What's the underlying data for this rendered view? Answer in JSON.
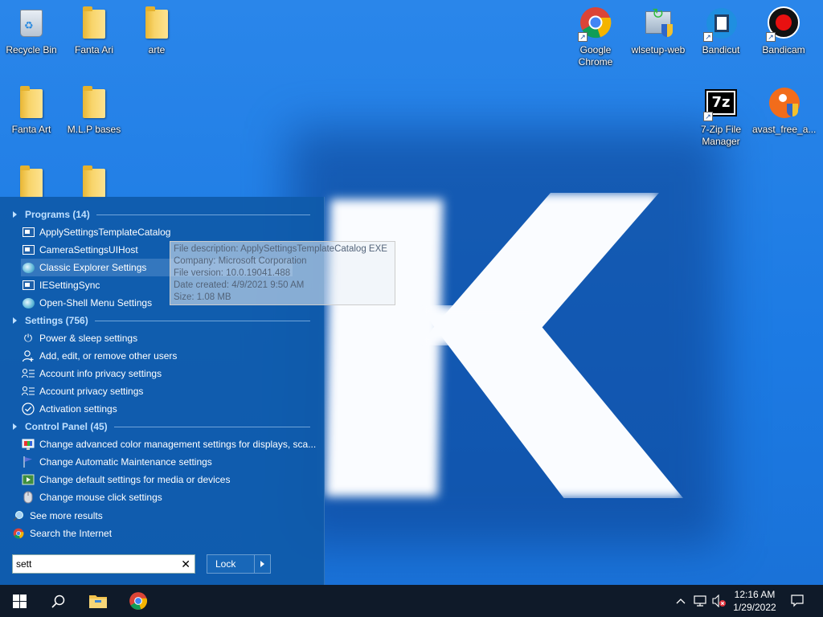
{
  "desktop": {
    "icons": [
      {
        "label": "Recycle Bin"
      },
      {
        "label": "Fanta Ari"
      },
      {
        "label": "arte"
      },
      {
        "label": "Fanta Art"
      },
      {
        "label": "M.L.P bases"
      },
      {
        "label": "Google Chrome"
      },
      {
        "label": "wlsetup-web"
      },
      {
        "label": "Bandicut"
      },
      {
        "label": "Bandicam"
      },
      {
        "label": "7-Zip File Manager"
      },
      {
        "label": "avast_free_a..."
      }
    ]
  },
  "start_menu": {
    "programs_header": "Programs (14)",
    "programs": [
      {
        "label": "ApplySettingsTemplateCatalog",
        "icon": "window-icon"
      },
      {
        "label": "CameraSettingsUIHost",
        "icon": "window-icon"
      },
      {
        "label": "Classic Explorer Settings",
        "icon": "shell-icon"
      },
      {
        "label": "IESettingSync",
        "icon": "window-icon"
      },
      {
        "label": "Open-Shell Menu Settings",
        "icon": "shell-icon"
      }
    ],
    "settings_header": "Settings (756)",
    "settings": [
      {
        "label": "Power & sleep settings",
        "icon": "power-icon"
      },
      {
        "label": "Add, edit, or remove other users",
        "icon": "person-icon"
      },
      {
        "label": "Account info privacy settings",
        "icon": "account-list-icon"
      },
      {
        "label": "Account privacy settings",
        "icon": "account-list-icon"
      },
      {
        "label": "Activation settings",
        "icon": "checkmark-circle-icon"
      }
    ],
    "control_panel_header": "Control Panel (45)",
    "control_panel": [
      {
        "label": "Change advanced color management settings for displays, sca...",
        "icon": "color-management-icon"
      },
      {
        "label": "Change Automatic Maintenance settings",
        "icon": "flag-icon"
      },
      {
        "label": "Change default settings for media or devices",
        "icon": "autoplay-icon"
      },
      {
        "label": "Change mouse click settings",
        "icon": "mouse-icon"
      }
    ],
    "see_more": "See more results",
    "search_internet": "Search the Internet",
    "search_value": "sett",
    "lock_label": "Lock"
  },
  "tooltip": {
    "description": "File description: ApplySettingsTemplateCatalog EXE",
    "company": "Company: Microsoft Corporation",
    "version": "File version: 10.0.19041.488",
    "created": "Date created: 4/9/2021 9:50 AM",
    "size": "Size: 1.08 MB"
  },
  "taskbar": {
    "time": "12:16 AM",
    "date": "1/29/2022"
  }
}
